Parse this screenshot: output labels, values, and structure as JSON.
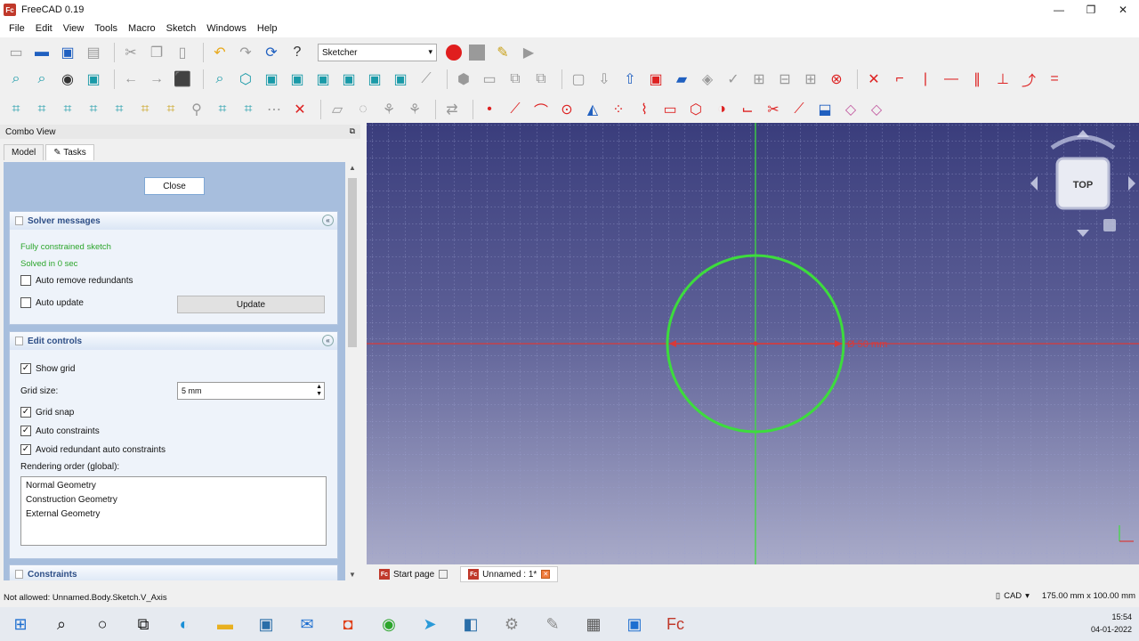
{
  "window": {
    "title": "FreeCAD 0.19",
    "logo": "Fc",
    "controls": [
      "—",
      "❐",
      "✕"
    ]
  },
  "menu": [
    "File",
    "Edit",
    "View",
    "Tools",
    "Macro",
    "Sketch",
    "Windows",
    "Help"
  ],
  "toolbar": {
    "workbench": "Sketcher"
  },
  "combo": {
    "title": "Combo View",
    "tabs": [
      "Model",
      "Tasks"
    ],
    "close_label": "Close",
    "solver": {
      "title": "Solver messages",
      "msg1": "Fully constrained sketch",
      "msg2": "Solved in 0 sec",
      "auto_remove": "Auto remove redundants",
      "auto_update": "Auto update",
      "update_label": "Update"
    },
    "edit": {
      "title": "Edit controls",
      "show_grid": "Show grid",
      "grid_size_label": "Grid size:",
      "grid_size_value": "5 mm",
      "grid_snap": "Grid snap",
      "auto_constraints": "Auto constraints",
      "avoid_redundant": "Avoid redundant auto constraints",
      "rendering_label": "Rendering order (global):",
      "rendering_items": [
        "Normal Geometry",
        "Construction Geometry",
        "External Geometry"
      ]
    },
    "constraints": {
      "title": "Constraints"
    }
  },
  "viewport": {
    "dimension_label": "Ø 50 mm",
    "navcube_face": "TOP",
    "circle_color": "#3ddc3d",
    "axis_color": "#d83a3a"
  },
  "doc_tabs": [
    {
      "label": "Start page"
    },
    {
      "label": "Unnamed : 1*"
    }
  ],
  "status": {
    "message": "Not allowed: Unnamed.Body.Sketch.V_Axis",
    "nav_style": "CAD",
    "dimensions": "175.00 mm x 100.00 mm"
  },
  "taskbar": {
    "time": "15:54",
    "date": "04-01-2022"
  }
}
